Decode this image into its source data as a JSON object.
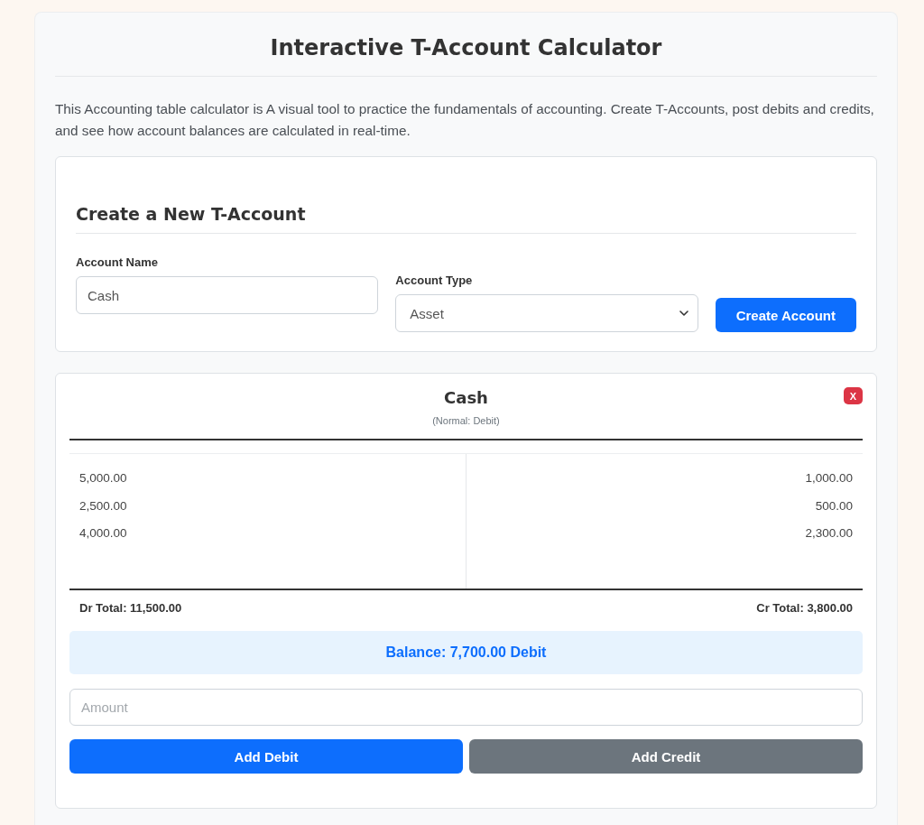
{
  "page": {
    "title": "Interactive T-Account Calculator",
    "intro": "This Accounting table calculator is A visual tool to practice the fundamentals of accounting. Create T-Accounts, post debits and credits, and see how account balances are calculated in real-time."
  },
  "create_form": {
    "heading": "Create a New T-Account",
    "fields": [
      {
        "label": "Account Name",
        "kind": "text",
        "value": "Cash"
      },
      {
        "label": "Account Type",
        "kind": "select",
        "value": "Asset"
      }
    ],
    "button": "Create Account"
  },
  "accounts": [
    {
      "name": "Cash",
      "normal": "(Normal: Debit)",
      "delete_button": "X",
      "debits": [
        "5,000.00",
        "2,500.00",
        "4,000.00"
      ],
      "credits": [
        "1,000.00",
        "500.00",
        "2,300.00"
      ],
      "debit_total": "Dr Total: 11,500.00",
      "credit_total": "Cr Total: 3,800.00",
      "balance": "Balance: 7,700.00 Debit",
      "amount_placeholder": "Amount",
      "buttons": [
        {
          "label": "Add Debit",
          "kind": "primary"
        },
        {
          "label": "Add Credit",
          "kind": "secondary"
        }
      ]
    }
  ]
}
